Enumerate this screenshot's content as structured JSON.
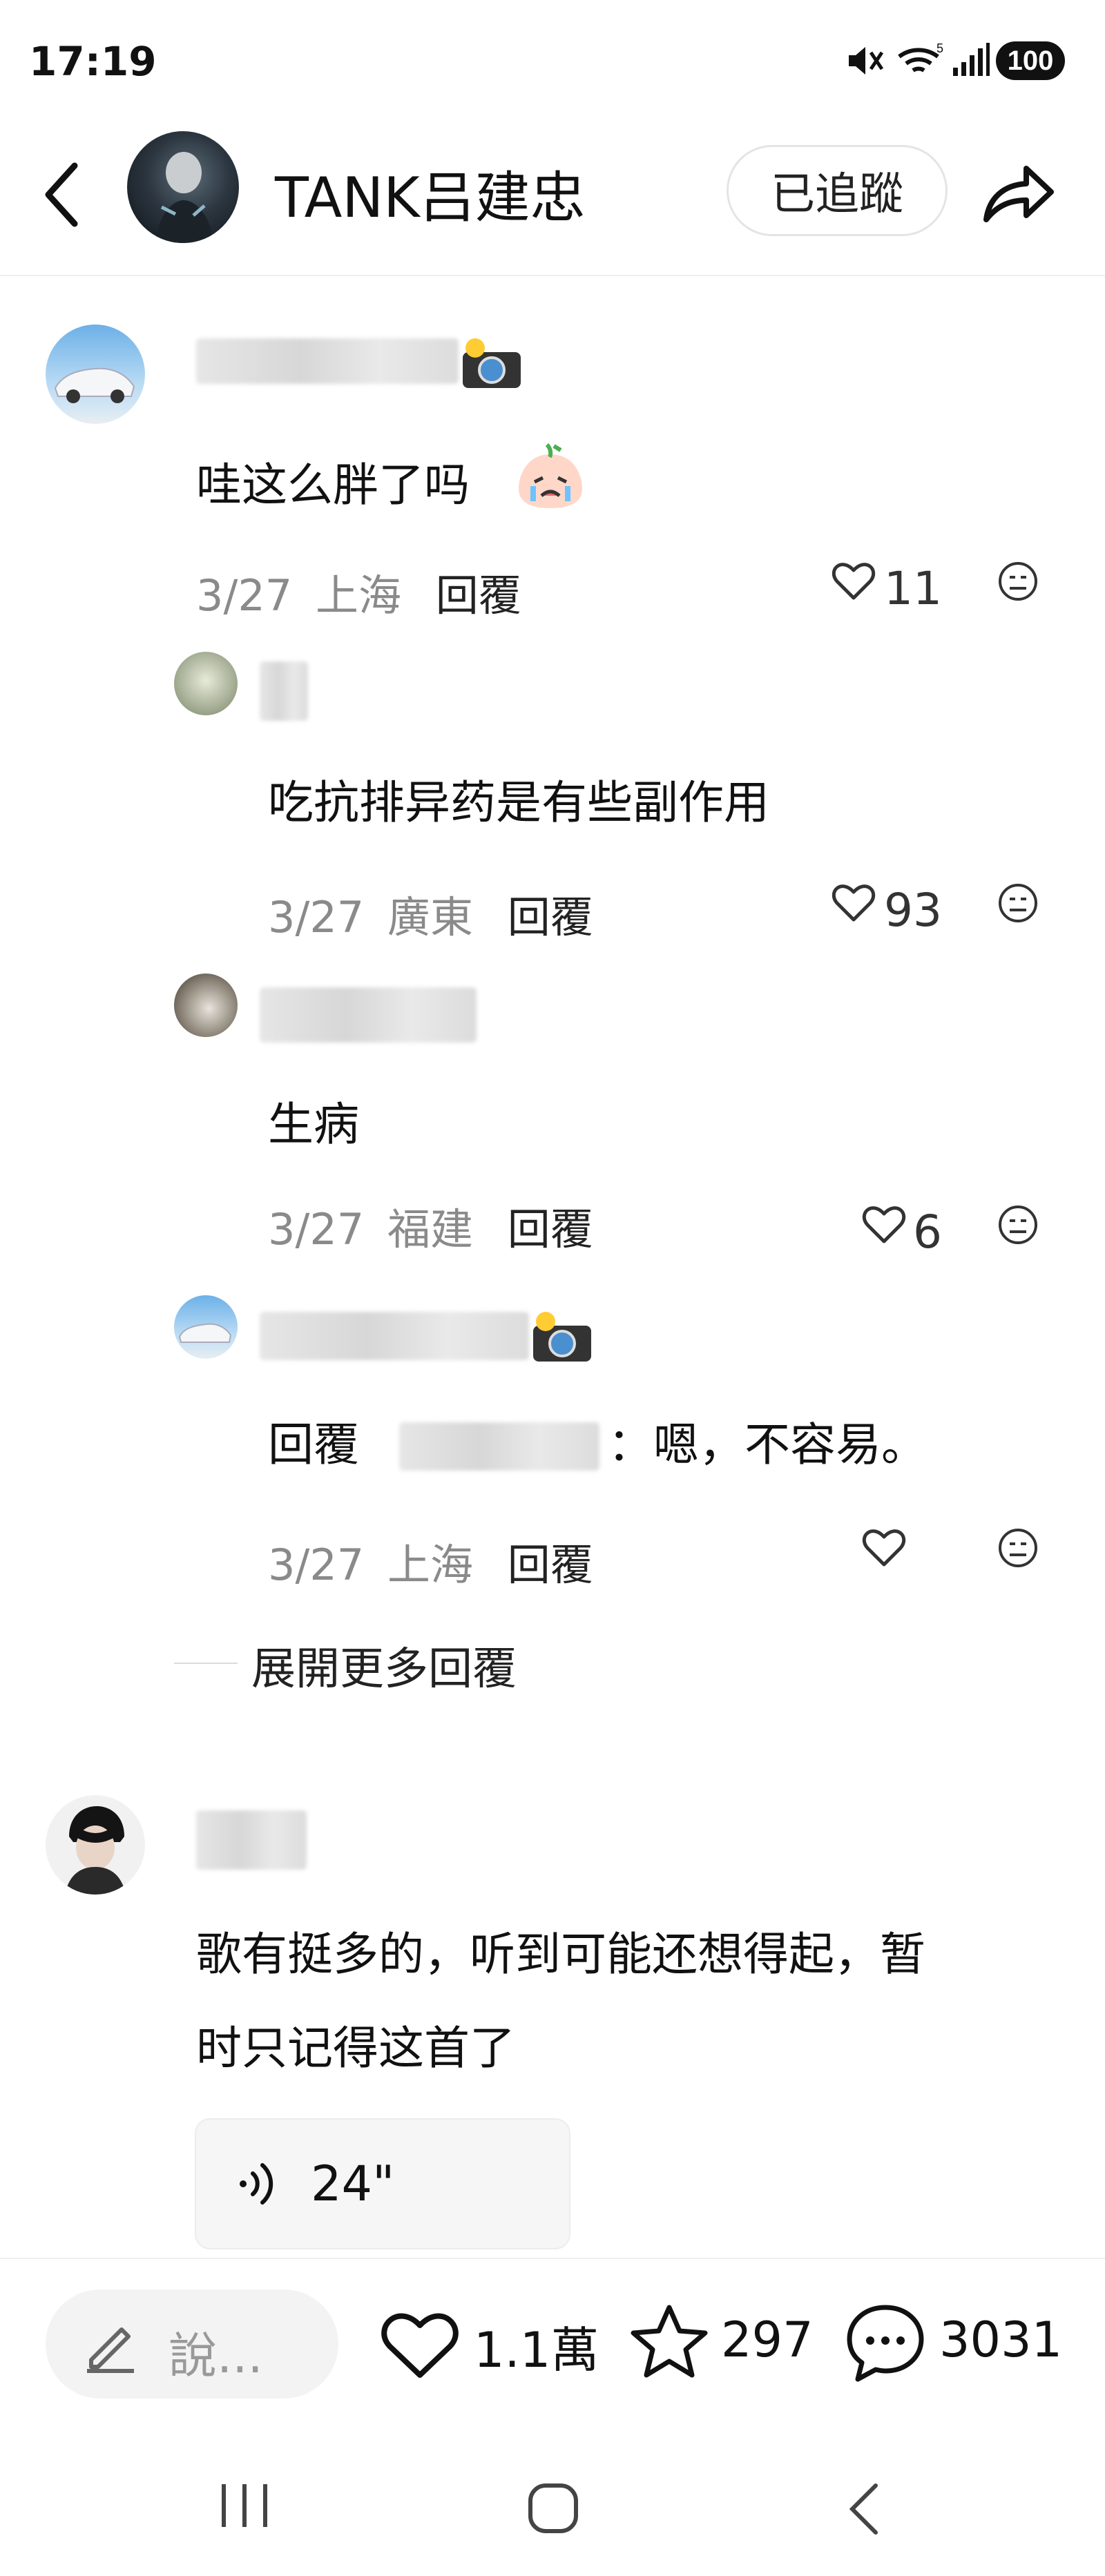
{
  "status_bar": {
    "time": "17:19",
    "battery": "100"
  },
  "header": {
    "title": "TANK吕建忠",
    "follow_label": "已追蹤"
  },
  "comments": [
    {
      "text": "哇这么胖了吗",
      "date": "3/27",
      "location": "上海",
      "reply_label": "回覆",
      "likes": "11"
    }
  ],
  "replies": [
    {
      "text": "吃抗排异药是有些副作用",
      "date": "3/27",
      "location": "廣東",
      "reply_label": "回覆",
      "likes": "93"
    },
    {
      "text": "生病",
      "date": "3/27",
      "location": "福建",
      "reply_label": "回覆",
      "likes": "6"
    },
    {
      "prefix": "回覆",
      "text": "：嗯，不容易。",
      "date": "3/27",
      "location": "上海",
      "reply_label": "回覆",
      "likes": ""
    }
  ],
  "expand_more": "展開更多回覆",
  "comment2": {
    "text_line1": "歌有挺多的，听到可能还想得起，暂",
    "text_line2": "时只记得这首了",
    "voice_duration": "24\""
  },
  "bottom_bar": {
    "input_placeholder": "說...",
    "likes": "1.1萬",
    "favorites": "297",
    "comments": "3031"
  },
  "colors": {
    "text": "#222222",
    "meta": "#8a8a8a",
    "divider": "#efefef",
    "input_bg": "#f3f3f3"
  }
}
